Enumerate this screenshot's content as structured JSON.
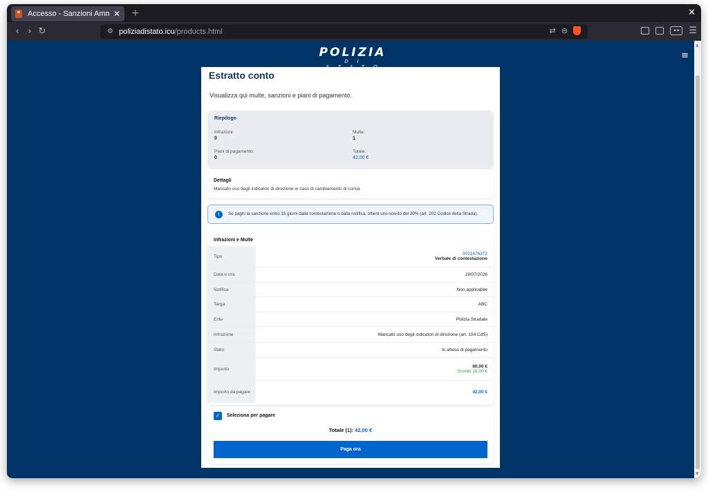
{
  "browser": {
    "tab_title": "Accesso - Sanzioni Amm",
    "url_host": "poliziadistato.icu",
    "url_path": "/products.html"
  },
  "site": {
    "logo_main": "POLIZIA",
    "logo_sub": "DI STATO"
  },
  "page": {
    "title": "Estratto conto",
    "subtitle": "Visualizza qui multe, sanzioni e piani di pagamento."
  },
  "summary": {
    "title": "Riepilogo",
    "fields": [
      {
        "label": "Infrazioni:",
        "value": "0"
      },
      {
        "label": "Multe:",
        "value": "1"
      },
      {
        "label": "Piani di pagamento:",
        "value": "0"
      },
      {
        "label": "Totale:",
        "value": "42,00 €"
      }
    ]
  },
  "details": {
    "title": "Dettagli",
    "text": "Mancato uso degli indicatori di direzione in caso di cambiamento di corsia"
  },
  "alert": {
    "text": "Se paghi la sanzione entro 15 giorni dalla contestazione o dalla notifica, ottieni uno sconto del 30% (art. 202 Codice della Strada)."
  },
  "violations": {
    "title": "Infrazioni e Multe",
    "rows": [
      {
        "label": "Tipo",
        "value": "0021476372",
        "value2": "Verbale di contestazione"
      },
      {
        "label": "Data e ora",
        "value": "19/07/2026"
      },
      {
        "label": "Notifica",
        "value": "Non applicabile"
      },
      {
        "label": "Targa",
        "value": "ABC"
      },
      {
        "label": "Ente",
        "value": "Polizia Stradale"
      },
      {
        "label": "Infrazione",
        "value": "Mancato uso degli indicatori di direzione (art. 154 CdS)"
      },
      {
        "label": "Stato",
        "value": "In attesa di pagamento"
      },
      {
        "label": "Importo",
        "value": "60,00 €",
        "value2": "Sconto 18,00 €"
      },
      {
        "label": "Importo da pagare",
        "value": "42,00 €"
      }
    ]
  },
  "payment": {
    "checkbox_label": "Seleziona per pagare",
    "total_label": "Totale (1):",
    "total_value": "42,00 €",
    "pay_button": "Paga ora"
  },
  "colors": {
    "background": "#003366",
    "accent": "#0066cc",
    "discount": "#2d9a4b"
  }
}
